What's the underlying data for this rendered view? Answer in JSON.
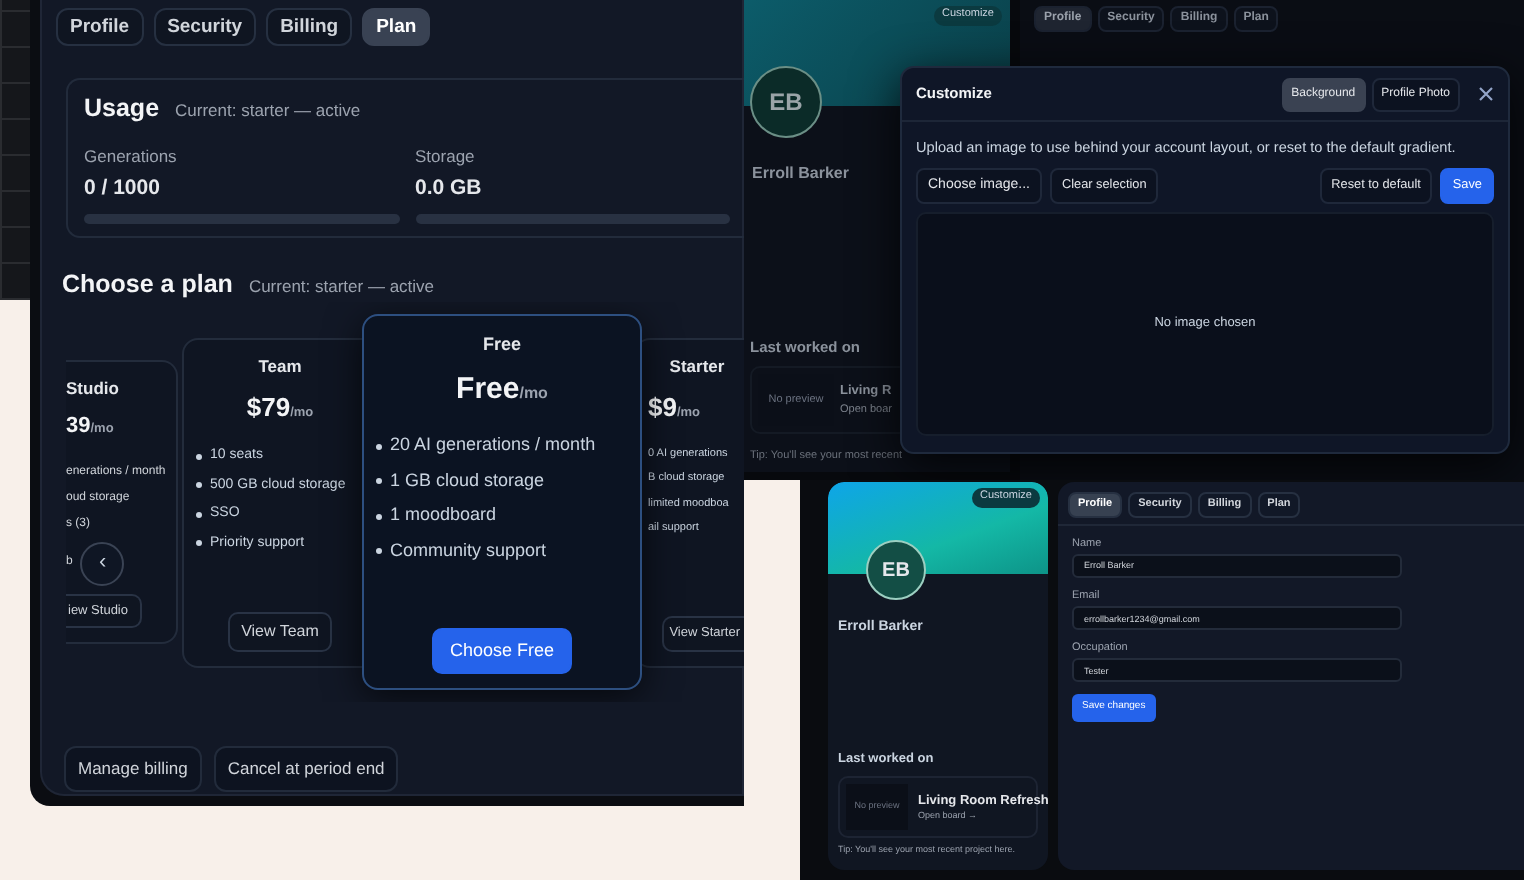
{
  "plan_screen": {
    "tabs": [
      {
        "label": "Profile",
        "selected": false
      },
      {
        "label": "Security",
        "selected": false
      },
      {
        "label": "Billing",
        "selected": false
      },
      {
        "label": "Plan",
        "selected": true
      }
    ],
    "usage": {
      "title": "Usage",
      "current": "Current: starter — active",
      "metrics": [
        {
          "label": "Generations",
          "value": "0 / 1000"
        },
        {
          "label": "Storage",
          "value": "0.0 GB"
        }
      ]
    },
    "choose": {
      "title": "Choose a plan",
      "current": "Current: starter — active"
    },
    "plans": [
      {
        "kind": "cut-left",
        "name": "Studio",
        "price": "39",
        "period": "/mo",
        "features": [
          "enerations / month",
          "oud storage",
          "s (3)",
          "b"
        ],
        "button": "iew Studio",
        "selected": false
      },
      {
        "kind": "full",
        "name": "Team",
        "price": "$79",
        "period": "/mo",
        "features": [
          "10 seats",
          "500 GB cloud storage",
          "SSO",
          "Priority support"
        ],
        "button": "View Team",
        "selected": false
      },
      {
        "kind": "full",
        "name": "Free",
        "price": "Free",
        "period": "/mo",
        "features": [
          "20 AI generations / month",
          "1 GB cloud storage",
          "1 moodboard",
          "Community support"
        ],
        "button": "Choose Free",
        "selected": true
      },
      {
        "kind": "cut-right",
        "name": "Starter",
        "price": "$9",
        "period": "/mo",
        "features": [
          "0 AI generations",
          "B cloud storage",
          "limited moodboa",
          "ail support"
        ],
        "button": "View Starter",
        "selected": false
      }
    ],
    "carousel_prev": "‹",
    "actions": [
      "Manage billing",
      "Cancel at period end"
    ]
  },
  "customize_screen": {
    "profile_card": {
      "badge": "Customize",
      "initials": "EB",
      "name": "Erroll Barker",
      "recent_title": "Last worked on",
      "preview": "No preview",
      "project": "Living R",
      "open": "Open boar",
      "tip": "Tip: You'll see your most recent"
    },
    "tabs": [
      {
        "label": "Profile",
        "selected": true
      },
      {
        "label": "Security",
        "selected": false
      },
      {
        "label": "Billing",
        "selected": false
      },
      {
        "label": "Plan",
        "selected": false
      }
    ],
    "modal": {
      "title": "Customize",
      "tabs": [
        {
          "label": "Background",
          "selected": true
        },
        {
          "label": "Profile Photo",
          "selected": false
        }
      ],
      "description": "Upload an image to use behind your account layout, or reset to the default gradient.",
      "left_buttons": [
        {
          "label": "Choose image...",
          "kind": "outline"
        },
        {
          "label": "Clear selection",
          "kind": "outline"
        }
      ],
      "right_buttons": [
        {
          "label": "Reset to default",
          "kind": "outline"
        },
        {
          "label": "Save",
          "kind": "primary"
        }
      ],
      "dropzone": "No image chosen"
    }
  },
  "profile_screen": {
    "profile_card": {
      "badge": "Customize",
      "initials": "EB",
      "name": "Erroll Barker",
      "recent_title": "Last worked on",
      "preview": "No preview",
      "project": "Living Room Refresh",
      "open": "Open board →",
      "tip": "Tip: You'll see your most recent project here."
    },
    "tabs": [
      {
        "label": "Profile",
        "selected": true
      },
      {
        "label": "Security",
        "selected": false
      },
      {
        "label": "Billing",
        "selected": false
      },
      {
        "label": "Plan",
        "selected": false
      }
    ],
    "fields": [
      {
        "label": "Name",
        "value": "Erroll Barker"
      },
      {
        "label": "Email",
        "value": "errollbarker1234@gmail.com"
      },
      {
        "label": "Occupation",
        "value": "Tester"
      }
    ],
    "save": "Save changes"
  }
}
